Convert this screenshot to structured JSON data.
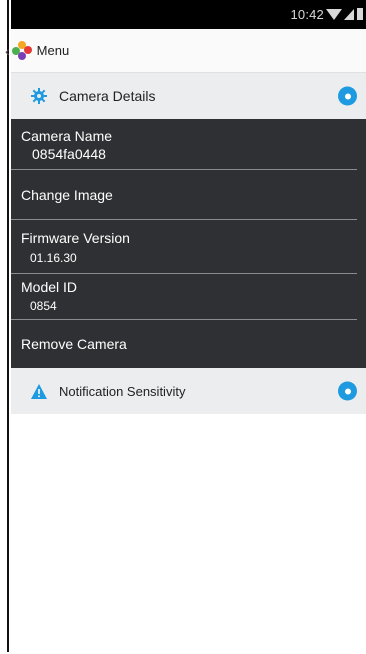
{
  "status_bar": {
    "time": "10:42"
  },
  "app_bar": {
    "back_icon": "chevron-left-icon",
    "logo_colors": [
      "#4caf50",
      "#f5a623",
      "#e53935",
      "#7b3fb5"
    ],
    "menu_label": "Menu"
  },
  "camera_details": {
    "title": "Camera Details",
    "icon": "gear-icon",
    "help_icon": "help-icon",
    "rows": {
      "camera_name_label": "Camera Name",
      "camera_name_value": "0854fa0448",
      "change_image_label": "Change Image",
      "firmware_label": "Firmware Version",
      "firmware_value": "01.16.30",
      "model_label": "Model ID",
      "model_value": "0854",
      "remove_label": "Remove Camera"
    }
  },
  "notification_sensitivity": {
    "title": "Notification Sensitivity",
    "icon": "warning-icon",
    "help_icon": "help-icon"
  },
  "colors": {
    "accent": "#1e9be0",
    "panel_bg": "#2e3033",
    "header_bg": "#ecedef"
  }
}
